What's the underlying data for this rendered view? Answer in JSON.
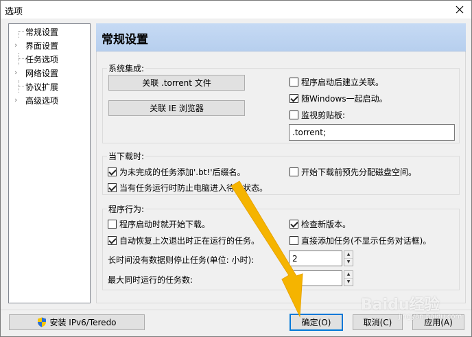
{
  "window": {
    "title": "选项"
  },
  "tree": {
    "items": [
      {
        "label": "常规设置",
        "expandable": false
      },
      {
        "label": "界面设置",
        "expandable": true
      },
      {
        "label": "任务选项",
        "expandable": false
      },
      {
        "label": "网络设置",
        "expandable": true
      },
      {
        "label": "协议扩展",
        "expandable": false
      },
      {
        "label": "高级选项",
        "expandable": true
      }
    ]
  },
  "page": {
    "title": "常规设置"
  },
  "system_integration": {
    "label": "系统集成:",
    "assoc_torrent_button": "关联 .torrent 文件",
    "assoc_ie_button": "关联 IE 浏览器",
    "build_assoc_on_start": {
      "label": "程序启动后建立关联。",
      "checked": false
    },
    "start_with_windows": {
      "label": "随Windows一起启动。",
      "checked": true
    },
    "monitor_clipboard": {
      "label": "监视剪贴板:",
      "checked": false
    },
    "clipboard_extensions": ".torrent;"
  },
  "when_downloading": {
    "label": "当下载时:",
    "add_bt_suffix": {
      "label": "为未完成的任务添加'.bt!'后缀名。",
      "checked": true
    },
    "prealloc_disk": {
      "label": "开始下载前预先分配磁盘空间。",
      "checked": false
    },
    "prevent_standby": {
      "label": "当有任务运行时防止电脑进入待机状态。",
      "checked": true
    }
  },
  "program_behavior": {
    "label": "程序行为:",
    "start_download_on_launch": {
      "label": "程序启动时就开始下载。",
      "checked": false
    },
    "check_new_version": {
      "label": "检查新版本。",
      "checked": true
    },
    "auto_resume": {
      "label": "自动恢复上次退出时正在运行的任务。",
      "checked": true
    },
    "add_task_directly": {
      "label": "直接添加任务(不显示任务对话框)。",
      "checked": false
    },
    "idle_stop_label": "长时间没有数据则停止任务(单位: 小时):",
    "idle_stop_value": "2",
    "max_tasks_label": "最大同时运行的任务数:",
    "max_tasks_value": "5"
  },
  "footer": {
    "install_ipv6_button": "安装 IPv6/Teredo",
    "ok_button": "确定(O)",
    "cancel_button": "取消(C)",
    "apply_button": "应用(A)"
  },
  "watermark": {
    "brand": "Baidu经验",
    "url": "jingyan.baidu.com"
  },
  "colors": {
    "header_band": "#c6daf4",
    "default_button_border": "#0078d7",
    "arrow": "#f5b400"
  },
  "icons": {
    "close": "close-icon",
    "shield": "uac-shield-icon",
    "expand": "chevron-right-icon"
  }
}
